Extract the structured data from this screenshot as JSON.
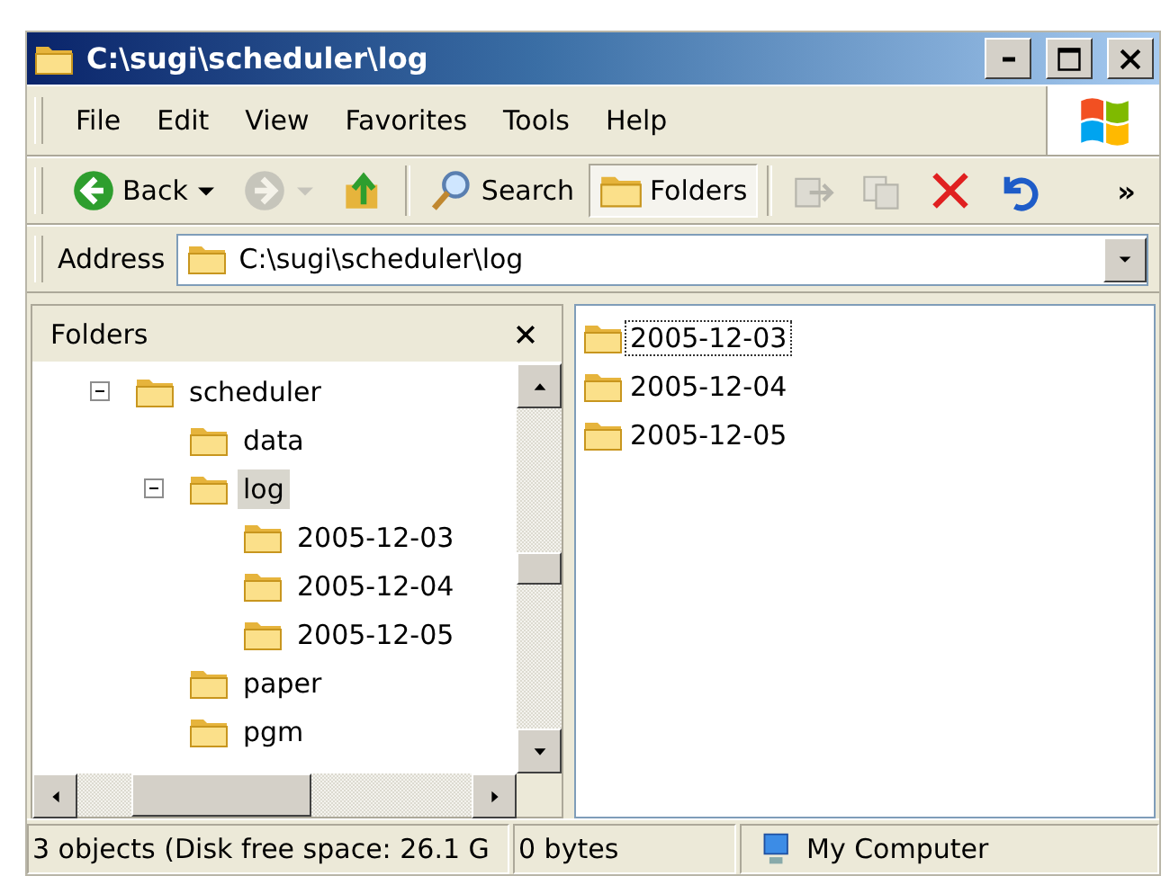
{
  "window": {
    "title": "C:\\sugi\\scheduler\\log"
  },
  "menu": [
    "File",
    "Edit",
    "View",
    "Favorites",
    "Tools",
    "Help"
  ],
  "toolbar": [
    {
      "kind": "back",
      "label": "Back",
      "dropdown": true,
      "disabled": false,
      "selected": false
    },
    {
      "kind": "forward",
      "dropdown": true,
      "disabled": true,
      "selected": false
    },
    {
      "kind": "up",
      "disabled": false,
      "selected": false
    },
    {
      "kind": "separator"
    },
    {
      "kind": "search",
      "label": "Search",
      "disabled": false,
      "selected": false
    },
    {
      "kind": "folders",
      "label": "Folders",
      "disabled": false,
      "selected": true
    },
    {
      "kind": "separator"
    },
    {
      "kind": "move",
      "disabled": true,
      "selected": false
    },
    {
      "kind": "copy",
      "disabled": true,
      "selected": false
    },
    {
      "kind": "delete",
      "disabled": false,
      "selected": false
    },
    {
      "kind": "undo",
      "disabled": false,
      "selected": false
    },
    {
      "kind": "more",
      "label": "»"
    }
  ],
  "address": {
    "label": "Address",
    "value": "C:\\sugi\\scheduler\\log"
  },
  "folders_pane": {
    "title": "Folders",
    "tree": [
      {
        "label": "scheduler",
        "expanded": true,
        "selected": false,
        "children": [
          {
            "label": "data",
            "selected": false
          },
          {
            "label": "log",
            "expanded": true,
            "selected": true,
            "children": [
              {
                "label": "2005-12-03",
                "selected": false
              },
              {
                "label": "2005-12-04",
                "selected": false
              },
              {
                "label": "2005-12-05",
                "selected": false
              }
            ]
          },
          {
            "label": "paper",
            "selected": false
          },
          {
            "label": "pgm",
            "selected": false
          }
        ]
      }
    ]
  },
  "files": [
    {
      "name": "2005-12-03",
      "focused": true
    },
    {
      "name": "2005-12-04",
      "focused": false
    },
    {
      "name": "2005-12-05",
      "focused": false
    }
  ],
  "status_bar": {
    "summary": "3 objects (Disk free space: 26.1 G",
    "size": "0 bytes",
    "zone": "My Computer"
  }
}
